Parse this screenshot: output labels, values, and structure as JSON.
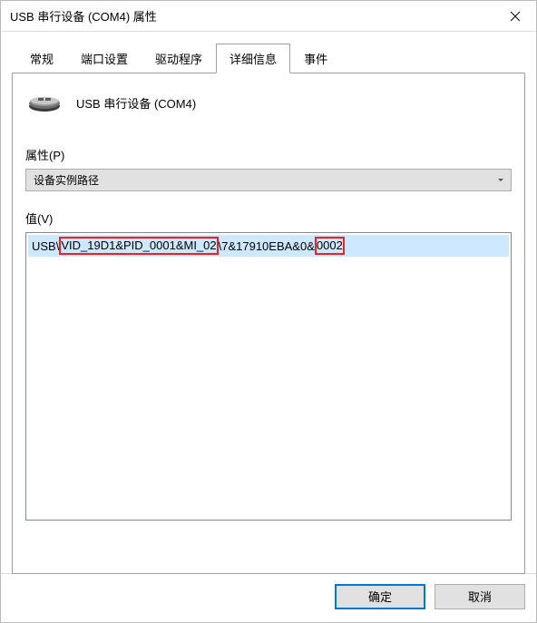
{
  "window": {
    "title": "USB 串行设备 (COM4) 属性"
  },
  "tabs": {
    "general": "常规",
    "port_settings": "端口设置",
    "driver": "驱动程序",
    "details": "详细信息",
    "events": "事件",
    "active": "details"
  },
  "device": {
    "name": "USB 串行设备 (COM4)"
  },
  "property_section": {
    "label": "属性(P)",
    "selected": "设备实例路径"
  },
  "value_section": {
    "label": "值(V)",
    "segments": {
      "pre": "USB\\",
      "hl1": "VID_19D1&PID_0001&MI_02",
      "mid": "\\7&17910EBA&0&",
      "hl2": "0002"
    },
    "selected_value": "USB\\VID_19D1&PID_0001&MI_02\\7&17910EBA&0&0002"
  },
  "buttons": {
    "ok": "确定",
    "cancel": "取消"
  }
}
